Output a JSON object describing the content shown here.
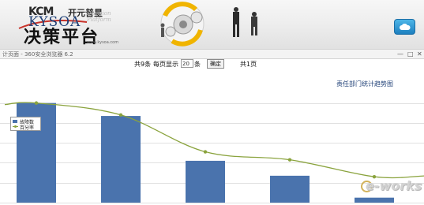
{
  "banner": {
    "brand_code": "KCM",
    "brand_cn": "开元普星",
    "brand_en": "KYSOA",
    "platform_name": "决策平台",
    "decision_en": "Decision Platform",
    "url": "www.kysoa.com",
    "cloud_button_icon": "cloud-icon"
  },
  "browser": {
    "title": "计页面 - 360安全浏览器 6.2",
    "minimize": "—",
    "maximize": "□",
    "close": "✕"
  },
  "pager": {
    "total_text": "共9条",
    "per_page_label": "每页显示",
    "per_page_value": "20",
    "per_page_unit": "条",
    "confirm_label": "确定",
    "pages_text": "共1页"
  },
  "chart_title": "责任部门统计趋势图",
  "legend": {
    "bar_label": "故障数",
    "line_label": "百分率"
  },
  "colors": {
    "bar": "#4a73ad",
    "line": "#8aa33d",
    "accent": "#1e3f76"
  },
  "chart_data": {
    "type": "bar",
    "categories": [
      "",
      "",
      "",
      "",
      ""
    ],
    "series": [
      {
        "name": "故障数",
        "type": "bar",
        "values": [
          100,
          87,
          42,
          27,
          5
        ]
      },
      {
        "name": "百分率",
        "type": "line",
        "values": [
          100,
          88,
          51,
          43,
          26
        ]
      }
    ],
    "ylim": [
      0,
      110
    ],
    "grid": true,
    "legend_position": "top-left"
  },
  "watermark": "e-works"
}
